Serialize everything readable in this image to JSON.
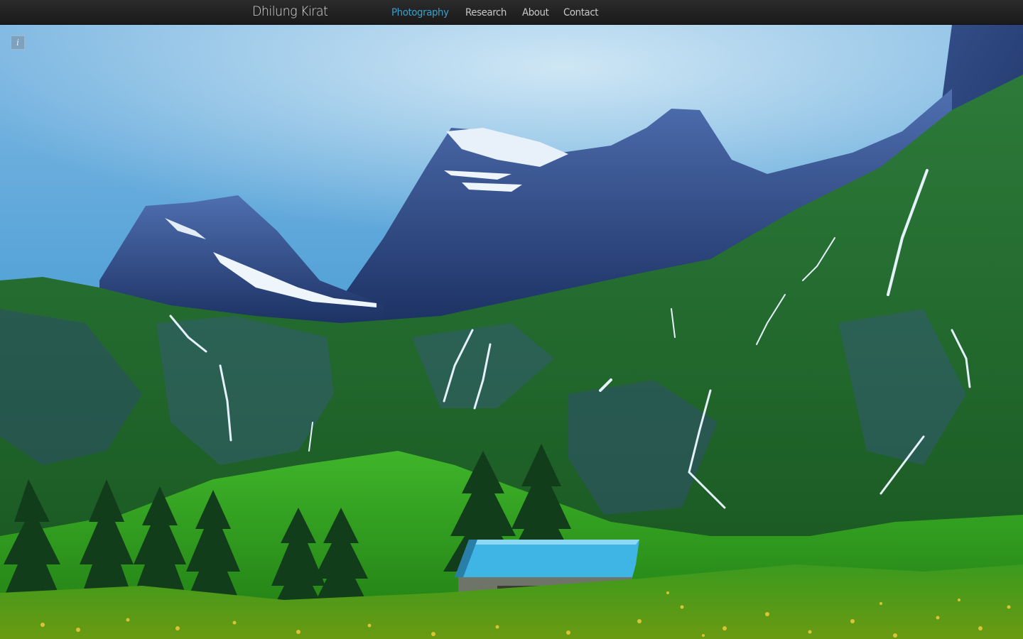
{
  "header": {
    "brand": "Dhilung Kirat",
    "nav": [
      {
        "label": "Photography",
        "active": true
      },
      {
        "label": "Research",
        "active": false
      },
      {
        "label": "About",
        "active": false
      },
      {
        "label": "Contact",
        "active": false
      }
    ]
  },
  "photo": {
    "subject": "mountain-landscape-with-hut",
    "info_icon": "info-icon",
    "info_glyph": "i"
  },
  "colors": {
    "nav_active": "#3ba0c9",
    "nav_text": "#c8c8c8",
    "topbar_bg": "#1f1f1f"
  }
}
